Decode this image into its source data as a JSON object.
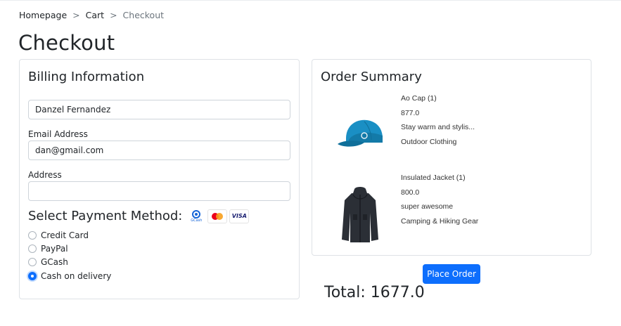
{
  "breadcrumb": {
    "home": "Homepage",
    "cart": "Cart",
    "current": "Checkout",
    "separator": ">"
  },
  "page_title": "Checkout",
  "billing": {
    "heading": "Billing Information",
    "name_value": "Danzel Fernandez",
    "email_label": "Email Address",
    "email_value": "dan@gmail.com",
    "address_label": "Address",
    "address_value": ""
  },
  "payment": {
    "heading": "Select Payment Method:",
    "logos": {
      "gcash": "GCash",
      "visa": "VISA"
    },
    "options": [
      {
        "label": "Credit Card",
        "checked": false
      },
      {
        "label": "PayPal",
        "checked": false
      },
      {
        "label": "GCash",
        "checked": false
      },
      {
        "label": "Cash on delivery",
        "checked": true
      }
    ]
  },
  "summary": {
    "heading": "Order Summary",
    "items": [
      {
        "name": "Ao Cap (1)",
        "price": "877.0",
        "description": "Stay warm and stylis...",
        "category": "Outdoor Clothing",
        "image": "blue-cap"
      },
      {
        "name": "Insulated Jacket (1)",
        "price": "800.0",
        "description": "super awesome",
        "category": "Camping & Hiking Gear",
        "image": "black-jacket"
      }
    ]
  },
  "place_order_label": "Place Order",
  "total": "Total: 1677.0",
  "colors": {
    "primary": "#0d6efd",
    "cap": "#1a8fc4",
    "jacket": "#2b2f36"
  }
}
